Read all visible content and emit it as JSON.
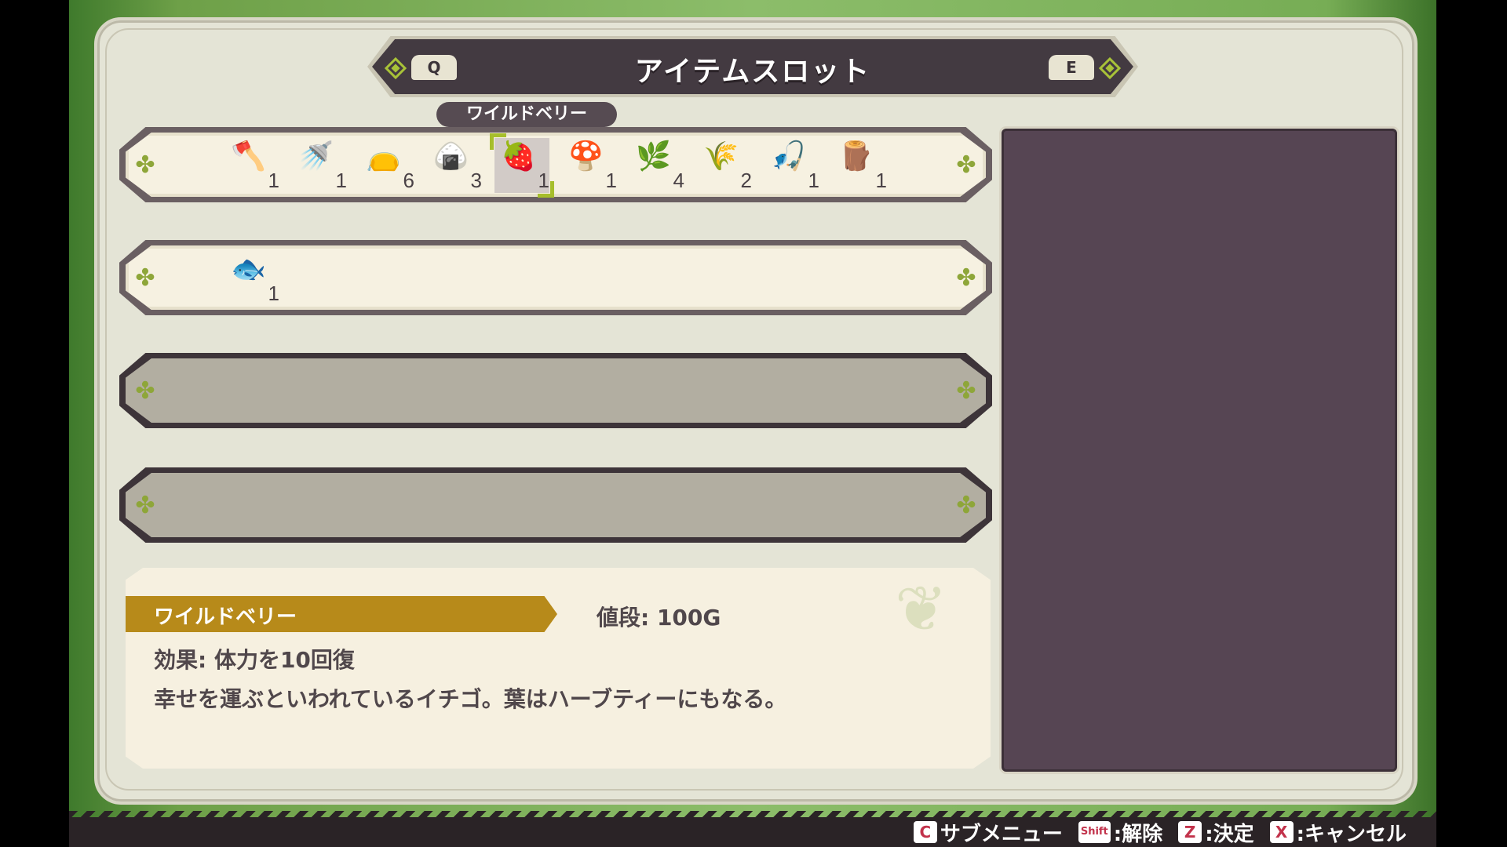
{
  "title": "アイテムスロット",
  "nav": {
    "prev_key": "Q",
    "next_key": "E"
  },
  "tooltip": "ワイルドベリー",
  "rows": [
    {
      "state": "active",
      "slots": [
        {
          "icon": "axe-icon",
          "glyph": "🪓",
          "count": "1"
        },
        {
          "icon": "watering-can-icon",
          "glyph": "🚿",
          "count": "1"
        },
        {
          "icon": "seed-bag-icon",
          "glyph": "👝",
          "count": "6"
        },
        {
          "icon": "rice-ball-icon",
          "glyph": "🍙",
          "count": "3"
        },
        {
          "icon": "wild-berry-icon",
          "glyph": "🍓",
          "count": "1",
          "selected": true
        },
        {
          "icon": "mushroom-icon",
          "glyph": "🍄",
          "count": "1"
        },
        {
          "icon": "herb-icon",
          "glyph": "🌿",
          "count": "4"
        },
        {
          "icon": "grass-icon",
          "glyph": "🌾",
          "count": "2"
        },
        {
          "icon": "fishing-rod-icon",
          "glyph": "🎣",
          "count": "1"
        },
        {
          "icon": "branch-icon",
          "glyph": "🪵",
          "count": "1"
        }
      ]
    },
    {
      "state": "active",
      "slots": [
        {
          "icon": "fish-icon",
          "glyph": "🐟",
          "count": "1"
        }
      ]
    },
    {
      "state": "empty",
      "slots": []
    },
    {
      "state": "empty",
      "slots": []
    }
  ],
  "item_detail": {
    "name": "ワイルドベリー",
    "price": "値段: 100G",
    "effect": "効果: 体力を10回復",
    "description": "幸せを運ぶといわれているイチゴ。葉はハーブティーにもなる。"
  },
  "controls": [
    {
      "key": "C",
      "label": "サブメニュー",
      "name": "submenu-control"
    },
    {
      "key": "Shift",
      "label": ":解除",
      "name": "release-control"
    },
    {
      "key": "Z",
      "label": ":決定",
      "name": "confirm-control"
    },
    {
      "key": "X",
      "label": ":キャンセル",
      "name": "cancel-control"
    }
  ]
}
